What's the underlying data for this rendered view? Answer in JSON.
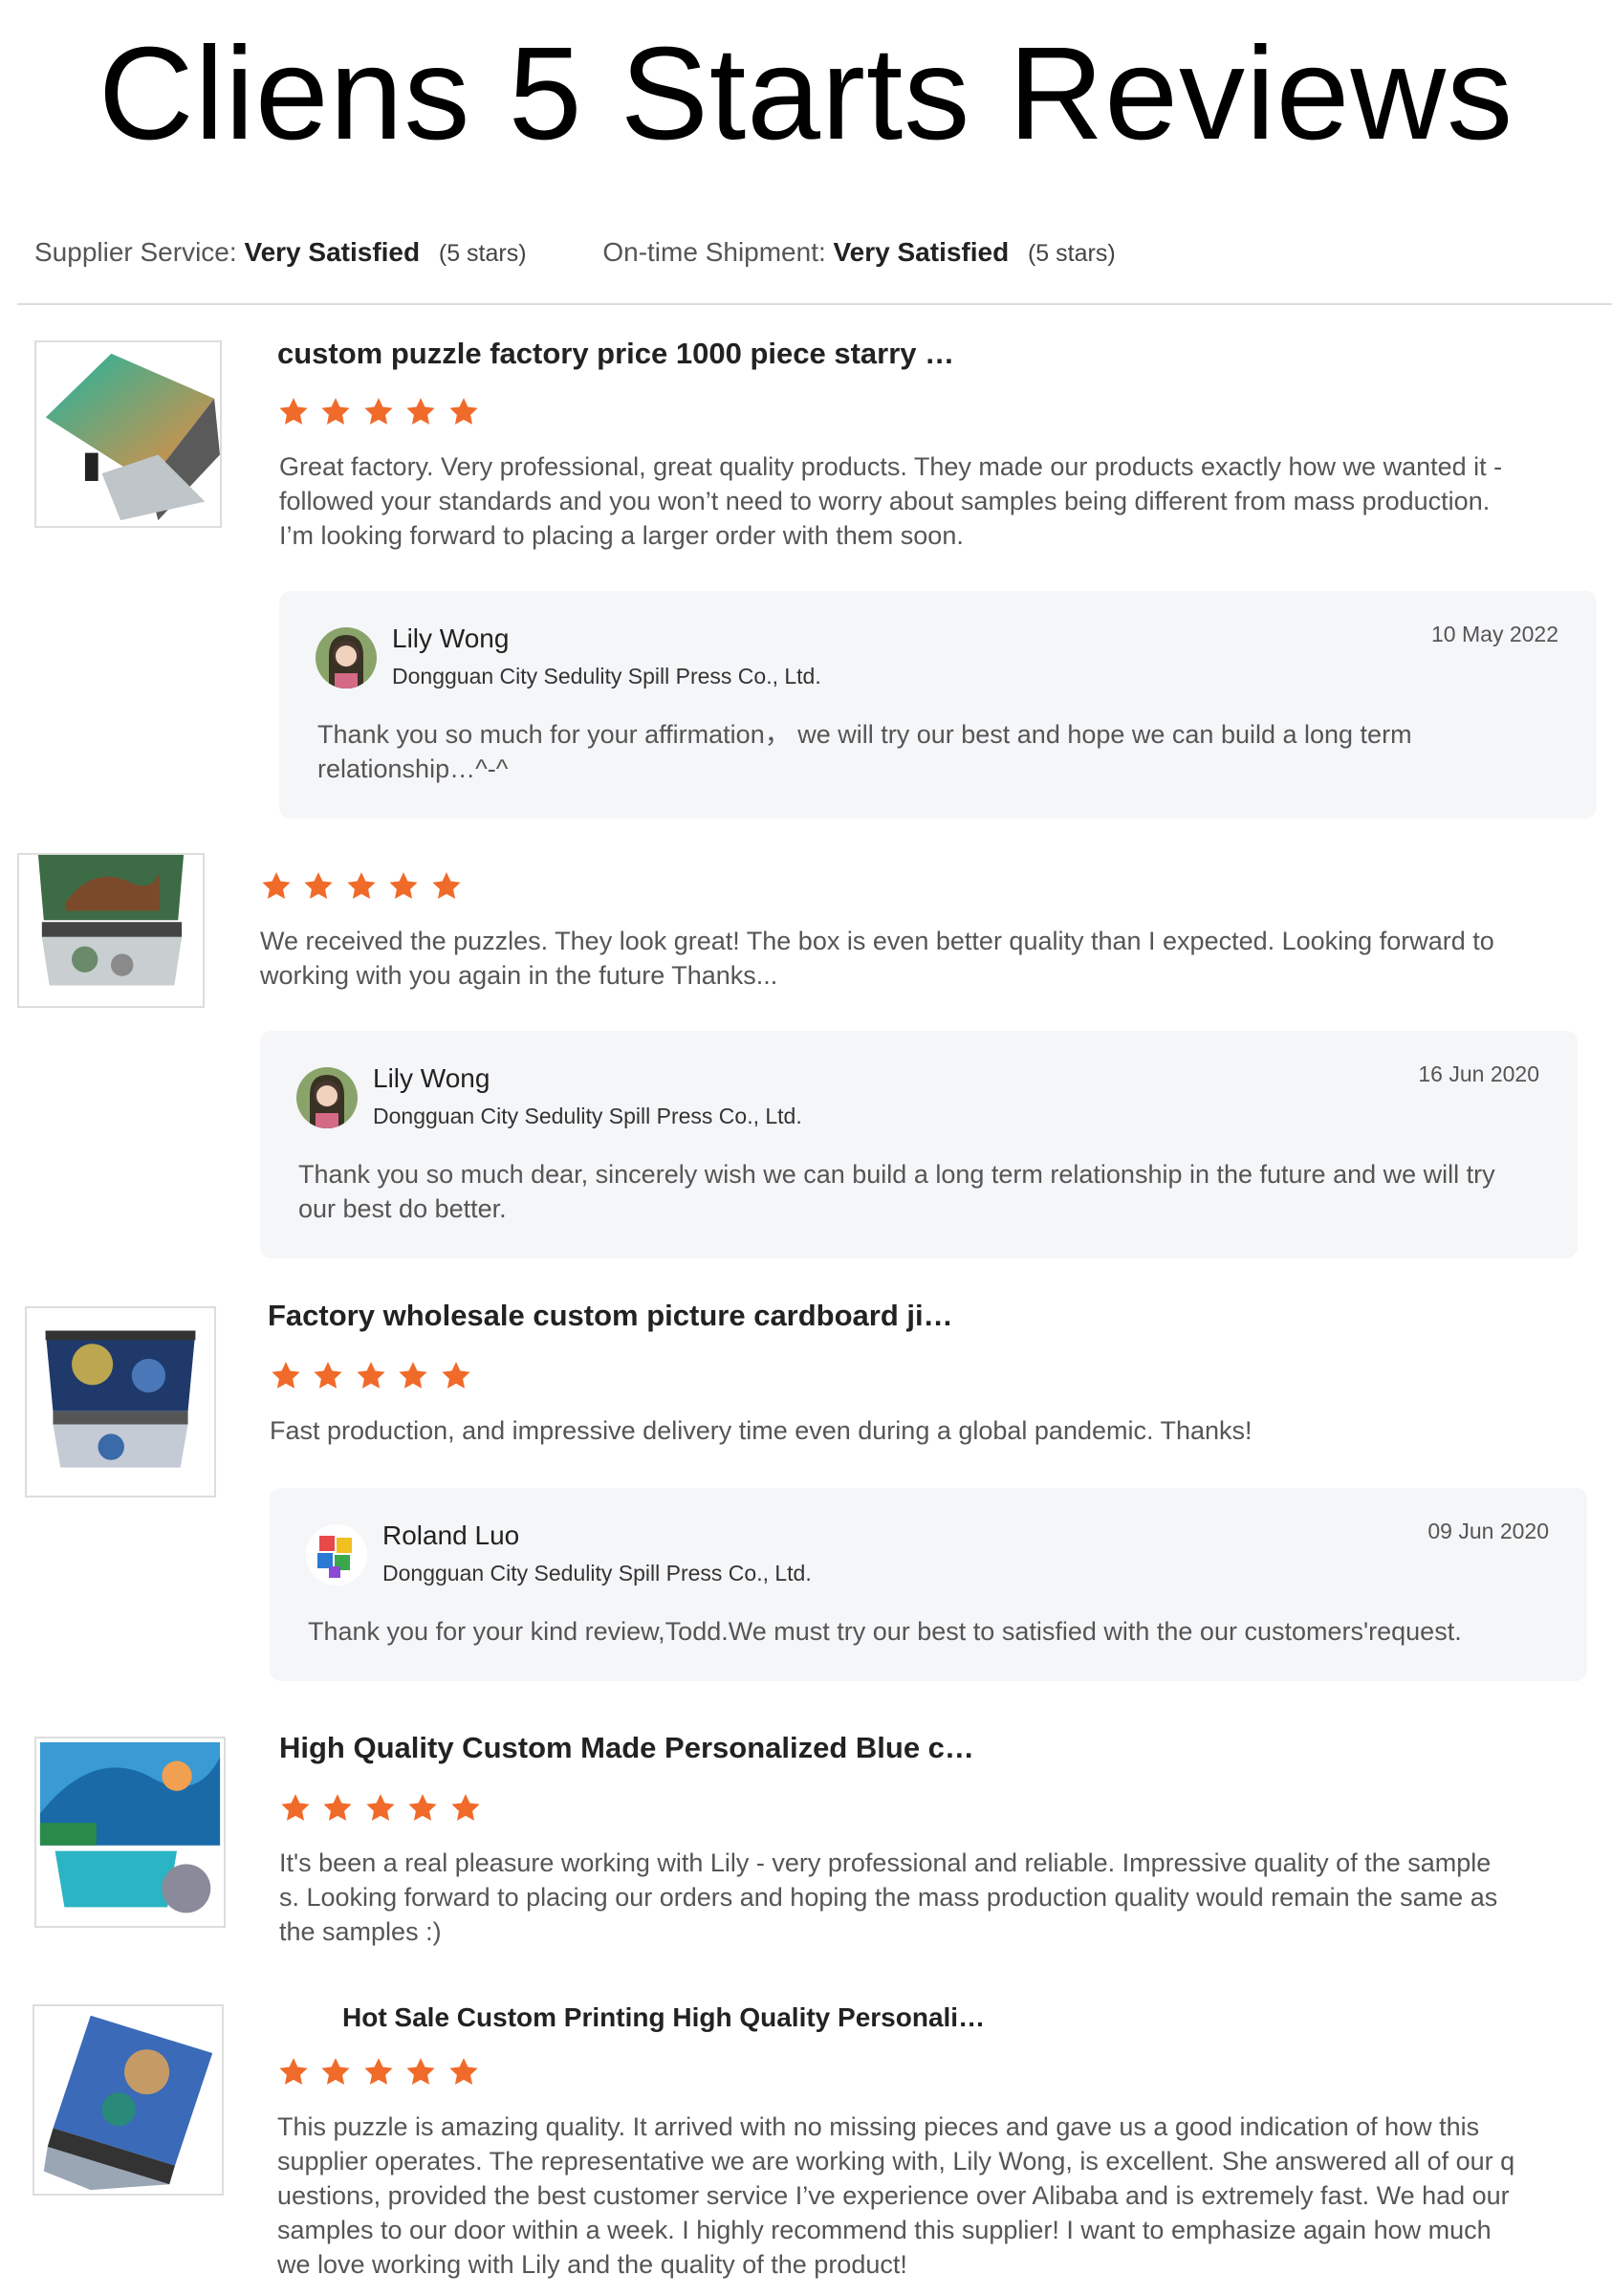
{
  "page": {
    "title": "Cliens 5 Starts Reviews"
  },
  "summary": {
    "supplier_service": {
      "label": "Supplier Service:",
      "value": "Very Satisfied",
      "stars_note": "(5 stars)"
    },
    "ontime_shipment": {
      "label": "On-time Shipment:",
      "value": "Very Satisfied",
      "stars_note": "(5 stars)"
    }
  },
  "colors": {
    "star": "#f06a2a",
    "reply_bg": "#f5f6f8",
    "divider": "#dddddd"
  },
  "reviews": [
    {
      "product_title": "custom puzzle factory price 1000 piece starry …",
      "rating": 5,
      "thumbnail_icon": "puzzle-box-gradient-icon",
      "text": "Great factory. Very professional, great quality products. They made our products exactly how we wanted it -\nfollowed your standards and you won’t need to worry about samples being different from mass production.\nI’m looking forward to placing a larger order with them soon.",
      "reply": {
        "name": "Lily Wong",
        "company": "Dongguan City Sedulity Spill Press Co., Ltd.",
        "date": "10 May 2022",
        "avatar_icon": "user-photo-icon",
        "text": "Thank you so much for your affirmation，  we will try our best and hope we can build a long term\nrelationship…^-^"
      }
    },
    {
      "product_title": "",
      "rating": 5,
      "thumbnail_icon": "puzzle-box-dinosaur-icon",
      "text": "We received the puzzles. They look great! The box is even better quality than I expected. Looking forward to\nworking with you again in the future Thanks...",
      "reply": {
        "name": "Lily Wong",
        "company": "Dongguan City Sedulity Spill Press Co., Ltd.",
        "date": "16 Jun 2020",
        "avatar_icon": "user-photo-icon",
        "text": "Thank you so much dear, sincerely wish we can build a long term relationship in the future and we will try\nour best do better."
      }
    },
    {
      "product_title": "Factory wholesale custom picture cardboard ji…",
      "rating": 5,
      "thumbnail_icon": "puzzle-box-starry-night-icon",
      "text": "Fast production, and impressive delivery time even during a global pandemic. Thanks!",
      "reply": {
        "name": "Roland Luo",
        "company": "Dongguan City Sedulity Spill Press Co., Ltd.",
        "date": "09 Jun 2020",
        "avatar_icon": "puzzle-pieces-avatar-icon",
        "text": "Thank you for your kind review,Todd.We must try our best to satisfied with the our customers'request."
      }
    },
    {
      "product_title": "High Quality Custom Made Personalized Blue c…",
      "rating": 5,
      "thumbnail_icon": "puzzle-box-wave-icon",
      "text": "It's been a real pleasure working with Lily - very professional and reliable. Impressive quality of the sample\ns. Looking forward to placing our orders and hoping the mass production quality would remain the same as\nthe samples :)"
    },
    {
      "product_title": "Hot Sale Custom Printing High Quality Personali…",
      "rating": 5,
      "thumbnail_icon": "puzzle-box-ocean-icon",
      "text": "This puzzle is amazing quality. It arrived with no missing pieces and gave us a good indication of how this\nsupplier operates. The representative we are working with, Lily Wong, is excellent. She answered all of our q\nuestions, provided the best customer service I’ve experience over Alibaba and is extremely fast. We had our\nsamples to our door within a week. I highly recommend this supplier! I want to emphasize again how much\nwe love working with Lily and the quality of the product!"
    }
  ]
}
